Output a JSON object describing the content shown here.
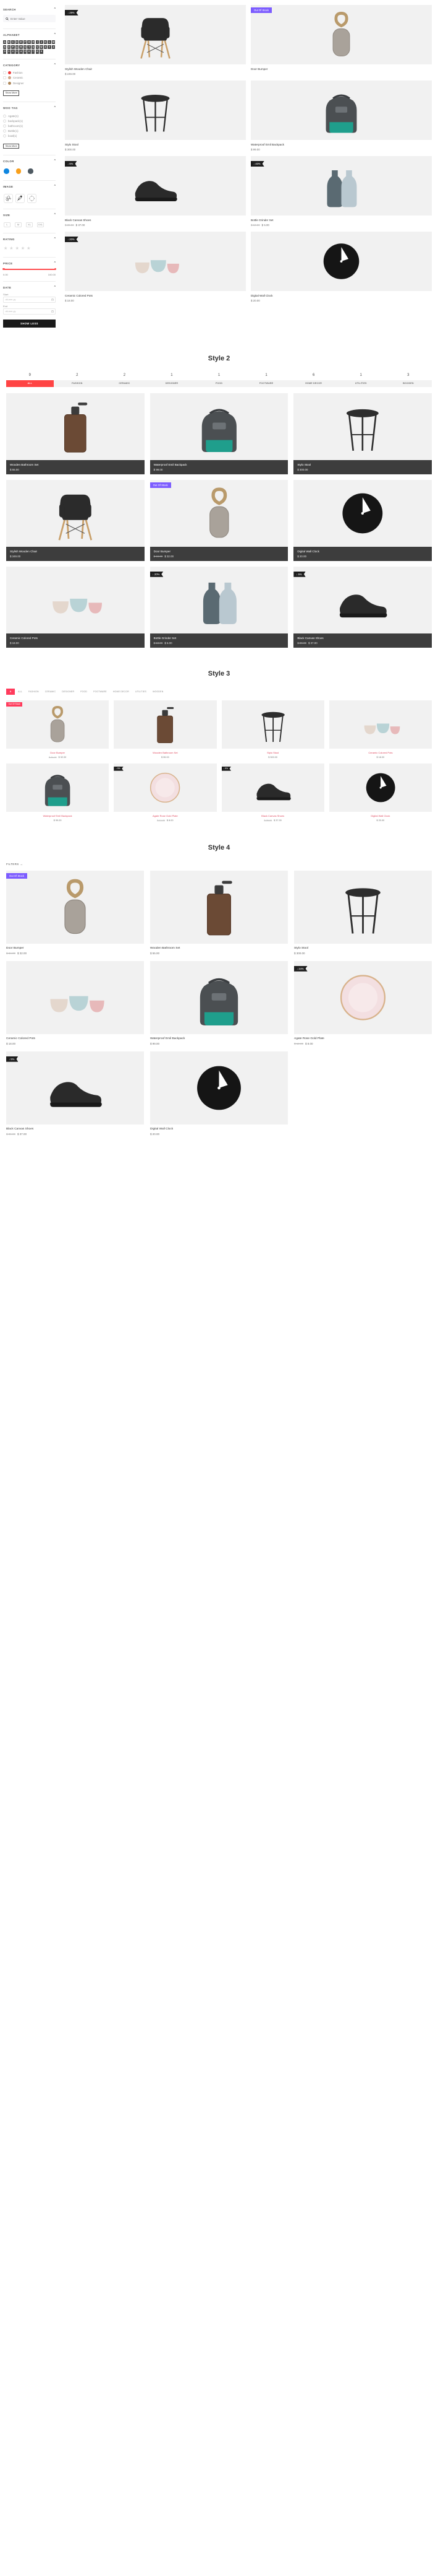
{
  "sidebar": {
    "search": {
      "title": "SEARCH",
      "placeholder": "Enter Value",
      "value": "",
      "icon": "search-icon"
    },
    "alphabet": {
      "title": "ALPHABET",
      "letters": [
        "A",
        "B",
        "C",
        "D",
        "E",
        "F",
        "G",
        "H",
        "I",
        "J",
        "K",
        "L",
        "M",
        "N",
        "O",
        "P",
        "Q",
        "R",
        "S",
        "T",
        "U",
        "V",
        "W",
        "X",
        "Y",
        "Z"
      ],
      "numbers": [
        "0",
        "1",
        "2",
        "3",
        "4",
        "5",
        "6",
        "7",
        "8",
        "9"
      ]
    },
    "category": {
      "title": "CATEGORY",
      "items": [
        {
          "label": "Fashion",
          "count": "3",
          "color": "#ef3b3b"
        },
        {
          "label": "Ceramic",
          "count": "2",
          "color": "#cfa98b"
        },
        {
          "label": "Designer",
          "count": "1",
          "color": "#b08a5e"
        }
      ],
      "show_more": "Show More"
    },
    "woo_tag": {
      "title": "WOO TAG",
      "items": [
        "Agate(1)",
        "backpack(1)",
        "bathroom(1)",
        "Bottle(1)",
        "bowl(1)"
      ],
      "show_more": "Show More"
    },
    "color": {
      "title": "COLOR",
      "swatches": [
        "#0f86e0",
        "#f9a01b",
        "#4e5a62"
      ]
    },
    "image": {
      "title": "IMAGE",
      "tiles": [
        "balloons-icon",
        "feather-icon",
        "circle-dots-icon"
      ]
    },
    "size": {
      "title": "SIZE",
      "options": [
        "L",
        "M",
        "XL",
        "XXL"
      ]
    },
    "rating": {
      "title": "RATING",
      "stars": 5
    },
    "price": {
      "title": "PRICE",
      "min": "0.00",
      "max": "100.00"
    },
    "date": {
      "title": "DATE",
      "start_label": "Start",
      "start_placeholder": "dd-mm-yy",
      "end_label": "End",
      "end_placeholder": "dd-mm-yy",
      "icon": "calendar-icon"
    },
    "show_less": "SHOW LESS"
  },
  "style1": {
    "products": [
      {
        "name": "Stylish Wooden Chair",
        "price": "$ 249.00",
        "old": "",
        "badge": "↓ 29%",
        "badge_type": "discount",
        "art": "chair"
      },
      {
        "name": "Door Bumper",
        "price": "",
        "old": "",
        "badge": "Out Of Stock",
        "badge_type": "oos",
        "art": "bumper"
      },
      {
        "name": "Stylo Stool",
        "price": "$ 300.00",
        "old": "",
        "badge": "",
        "badge_type": "",
        "art": "stool"
      },
      {
        "name": "Waterproof Emil Backpack",
        "price": "$ 99.00",
        "old": "",
        "badge": "",
        "badge_type": "",
        "art": "backpack"
      },
      {
        "name": "Black Canvas Shoes",
        "price": "$ 37.00",
        "old": "$ 39.00",
        "badge": "↓ 5%",
        "badge_type": "discount",
        "art": "shoes"
      },
      {
        "name": "Bottle Grinder Set",
        "price": "$ 6.00",
        "old": "$ 10.00",
        "badge": "↓ 40%",
        "badge_type": "discount",
        "art": "bottles"
      },
      {
        "name": "Ceramic Colored Pots",
        "price": "$ 18.00",
        "old": "",
        "badge": "↓ 20%",
        "badge_type": "discount",
        "art": "pots"
      },
      {
        "name": "Digital Wall Clock",
        "price": "$ 20.00",
        "old": "",
        "badge": "",
        "badge_type": "",
        "art": "clock"
      }
    ]
  },
  "style2": {
    "heading": "Style 2",
    "counts": [
      "9",
      "2",
      "2",
      "1",
      "1",
      "1",
      "6",
      "1",
      "3"
    ],
    "tabs": [
      {
        "label": "ALL",
        "active": true
      },
      {
        "label": "FASHION",
        "active": false
      },
      {
        "label": "CERAMIC",
        "active": false
      },
      {
        "label": "DESIGNER",
        "active": false
      },
      {
        "label": "FOOD",
        "active": false
      },
      {
        "label": "FOOTWARE",
        "active": false
      },
      {
        "label": "HOME DECOR",
        "active": false
      },
      {
        "label": "UTILITIES",
        "active": false
      },
      {
        "label": "WOODEN",
        "active": false
      }
    ],
    "products": [
      {
        "name": "Wooden Bathroom Set",
        "price": "$ 55.00",
        "old": "",
        "badge": "",
        "badge_type": "",
        "art": "bathroomset"
      },
      {
        "name": "Waterproof Emil Backpack",
        "price": "$ 99.00",
        "old": "",
        "badge": "",
        "badge_type": "",
        "art": "backpack"
      },
      {
        "name": "Stylo Stool",
        "price": "$ 300.00",
        "old": "",
        "badge": "",
        "badge_type": "",
        "art": "stool"
      },
      {
        "name": "Stylish Wooden Chair",
        "price": "$ 349.00",
        "old": "",
        "badge": "",
        "badge_type": "",
        "art": "chair"
      },
      {
        "name": "Door Bumper",
        "price": "$ 32.00",
        "old": "$ 34.00",
        "badge": "Out Of Stock",
        "badge_type": "oos",
        "art": "bumper"
      },
      {
        "name": "Digital Wall Clock",
        "price": "$ 20.00",
        "old": "",
        "badge": "",
        "badge_type": "",
        "art": "clock"
      },
      {
        "name": "Ceramic Colored Pots",
        "price": "$ 18.00",
        "old": "",
        "badge": "",
        "badge_type": "",
        "art": "pots"
      },
      {
        "name": "Bottle Grinder Set",
        "price": "$ 6.00",
        "old": "$ 10.00",
        "badge": "↓ 20%",
        "badge_type": "discount",
        "art": "bottles"
      },
      {
        "name": "Black Canvas Shoes",
        "price": "$ 37.00",
        "old": "$ 39.00",
        "badge": "↓ 5%",
        "badge_type": "discount",
        "art": "shoes"
      }
    ]
  },
  "style3": {
    "heading": "Style 3",
    "tabs": [
      {
        "label": "9",
        "active": true
      },
      {
        "label": "ALL",
        "active": false
      },
      {
        "label": "FASHION",
        "active": false
      },
      {
        "label": "CERAMIC",
        "active": false
      },
      {
        "label": "DESIGNER",
        "active": false
      },
      {
        "label": "FOOD",
        "active": false
      },
      {
        "label": "FOOTWARE",
        "active": false
      },
      {
        "label": "HOME DECOR",
        "active": false
      },
      {
        "label": "UTILITIES",
        "active": false
      },
      {
        "label": "WOODEN",
        "active": false
      }
    ],
    "products": [
      {
        "name": "Door Bumper",
        "price": "$ 32.00",
        "old": "$ 34.00",
        "badge": "Out Of Stock",
        "badge_type": "oos",
        "art": "bumper"
      },
      {
        "name": "Wooden Bathroom Set",
        "price": "$ 55.00",
        "old": "",
        "badge": "",
        "badge_type": "",
        "art": "bathroomset"
      },
      {
        "name": "Stylo Stool",
        "price": "$ 300.00",
        "old": "",
        "badge": "",
        "badge_type": "",
        "art": "stool"
      },
      {
        "name": "Ceramic Colored Pots",
        "price": "$ 18.00",
        "old": "",
        "badge": "",
        "badge_type": "",
        "art": "pots"
      },
      {
        "name": "Waterproof Emil Backpack",
        "price": "$ 99.00",
        "old": "",
        "badge": "",
        "badge_type": "",
        "art": "backpack"
      },
      {
        "name": "Agate Rose Gold Plate",
        "price": "$ 8.00",
        "old": "$ 12.00",
        "badge": "↓ 5%",
        "badge_type": "discount",
        "art": "plate"
      },
      {
        "name": "Black Canvas Shoes",
        "price": "$ 37.00",
        "old": "$ 39.00",
        "badge": "↓ 5%",
        "badge_type": "discount",
        "art": "shoes"
      },
      {
        "name": "Digital Wall Clock",
        "price": "$ 20.00",
        "old": "",
        "badge": "",
        "badge_type": "",
        "art": "clock"
      }
    ]
  },
  "style4": {
    "heading": "Style 4",
    "filters_label": "FILTERS →",
    "products": [
      {
        "name": "Door Bumper",
        "price": "$ 32.00",
        "old": "$ 34.00",
        "badge": "Out Of Stock",
        "badge_type": "oos",
        "art": "bumper"
      },
      {
        "name": "Wooden Bathroom Set",
        "price": "$ 55.00",
        "old": "",
        "badge": "",
        "badge_type": "",
        "art": "bathroomset"
      },
      {
        "name": "Stylo Stool",
        "price": "$ 300.00",
        "old": "",
        "badge": "",
        "badge_type": "",
        "art": "stool"
      },
      {
        "name": "Ceramic Colored Pots",
        "price": "$ 18.00",
        "old": "",
        "badge": "",
        "badge_type": "",
        "art": "pots"
      },
      {
        "name": "Waterproof Emil Backpack",
        "price": "$ 99.00",
        "old": "",
        "badge": "",
        "badge_type": "",
        "art": "backpack"
      },
      {
        "name": "Agate Rose Gold Plate",
        "price": "$ 8.00",
        "old": "$ 12.00",
        "badge": "↓ 34%",
        "badge_type": "discount",
        "art": "plate"
      },
      {
        "name": "Black Canvas Shoes",
        "price": "$ 37.00",
        "old": "$ 39.00",
        "badge": "↓ 5%",
        "badge_type": "discount",
        "art": "shoes"
      },
      {
        "name": "Digital Wall Clock",
        "price": "$ 20.00",
        "old": "",
        "badge": "",
        "badge_type": "",
        "art": "clock"
      }
    ]
  }
}
